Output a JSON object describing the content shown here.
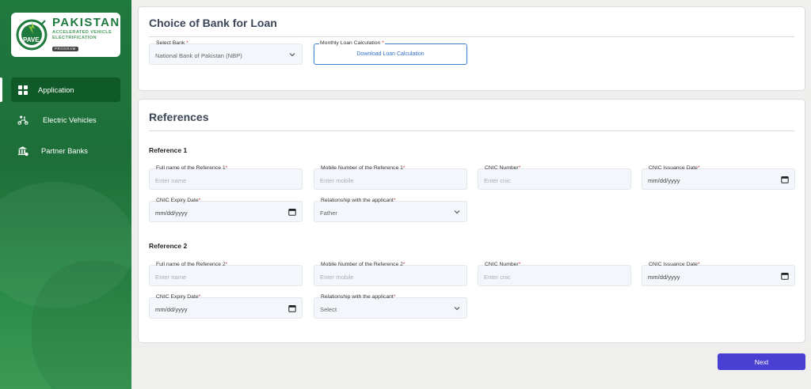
{
  "sidebar": {
    "logo": {
      "title": "PAKISTAN",
      "subtitle_line1": "ACCELERATED VEHICLE",
      "subtitle_line2": "ELECTRIFICATION",
      "program": "PROGRAM",
      "mark_text": "PAVE",
      "brand_color": "#1f7a3e"
    },
    "items": [
      {
        "label": "Application",
        "icon": "grid-icon",
        "active": true
      },
      {
        "label": "Electric Vehicles",
        "icon": "scooter-icon",
        "active": false
      },
      {
        "label": "Partner Banks",
        "icon": "bank-icon",
        "active": false
      }
    ]
  },
  "bank_section": {
    "title": "Choice of Bank for Loan",
    "select_bank": {
      "label": "Select Bank",
      "required": "*",
      "value": "National Bank of Pakistan (NBP)"
    },
    "loan_calc": {
      "label": "Monthly Loan Calculation",
      "required": "*",
      "link": "Download Loan Calculation"
    }
  },
  "references": {
    "title": "References",
    "refs": [
      {
        "heading": "Reference 1",
        "full_name": {
          "label": "Full name of the Reference 1",
          "placeholder": "Enter name"
        },
        "mobile": {
          "label": "Mobile Number of the Reference 1",
          "placeholder": "Enter mobile"
        },
        "cnic": {
          "label": "CNIC Number",
          "placeholder": "Enter cnic"
        },
        "issuance": {
          "label": "CNIC Issuance Date",
          "value": "mm/dd/yyyy"
        },
        "expiry": {
          "label": "CNIC Expiry Date",
          "value": "mm/dd/yyyy"
        },
        "relationship": {
          "label": "Relationship with the applicant",
          "value": "Father"
        }
      },
      {
        "heading": "Reference 2",
        "full_name": {
          "label": "Full name of the Reference 2",
          "placeholder": "Enter name"
        },
        "mobile": {
          "label": "Mobile Number of the Reference 2",
          "placeholder": "Enter mobile"
        },
        "cnic": {
          "label": "CNIC Number",
          "placeholder": "Enter cnic"
        },
        "issuance": {
          "label": "CNIC Issuance Date",
          "value": "mm/dd/yyyy"
        },
        "expiry": {
          "label": "CNIC Expiry Date",
          "value": "mm/dd/yyyy"
        },
        "relationship": {
          "label": "Relationship with the applicant",
          "value": "Select"
        }
      }
    ],
    "required_mark": "*"
  },
  "footer": {
    "next_label": "Next",
    "next_color": "#4a3fd3"
  }
}
